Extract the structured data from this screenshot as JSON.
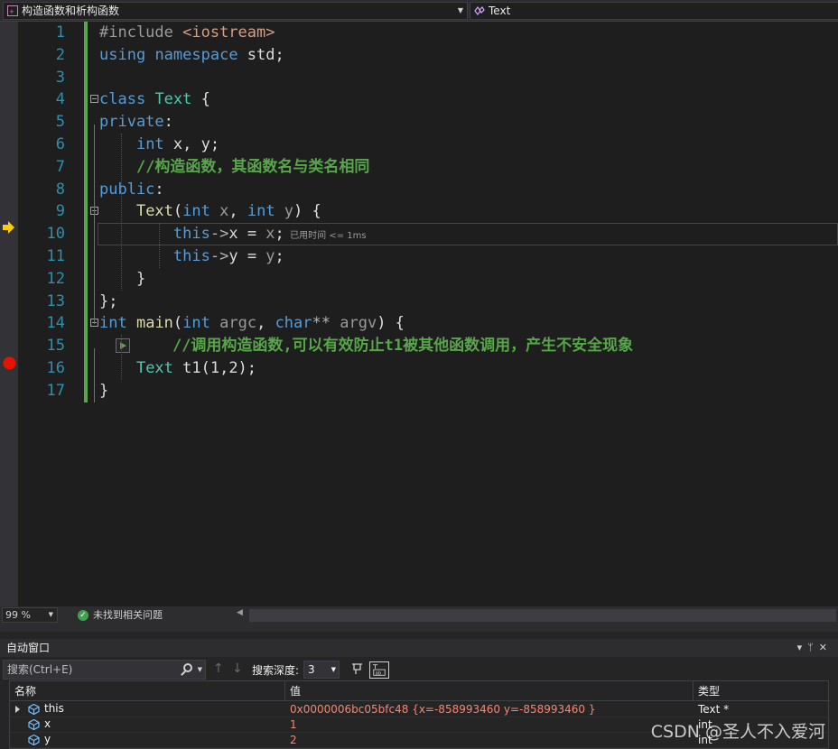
{
  "navbar": {
    "scope_label": "构造函数和析构函数",
    "member_label": "Text",
    "scope_icon": "cpp-file-icon",
    "member_icon": "class-icon"
  },
  "editor": {
    "lines": [
      {
        "n": "1",
        "tokens": [
          {
            "t": "#include ",
            "c": "pp"
          },
          {
            "t": "<iostream>",
            "c": "inc"
          }
        ]
      },
      {
        "n": "2",
        "tokens": [
          {
            "t": "using",
            "c": "kw"
          },
          {
            "t": " "
          },
          {
            "t": "namespace",
            "c": "kw"
          },
          {
            "t": " std;"
          }
        ]
      },
      {
        "n": "3",
        "tokens": []
      },
      {
        "n": "4",
        "tokens": [
          {
            "t": "class",
            "c": "kw"
          },
          {
            "t": " "
          },
          {
            "t": "Text",
            "c": "ty"
          },
          {
            "t": " {"
          }
        ]
      },
      {
        "n": "5",
        "tokens": [
          {
            "t": "private",
            "c": "kw"
          },
          {
            "t": ":"
          }
        ]
      },
      {
        "n": "6",
        "tokens": [
          {
            "t": "    "
          },
          {
            "t": "int",
            "c": "kw"
          },
          {
            "t": " x, y;"
          }
        ]
      },
      {
        "n": "7",
        "tokens": [
          {
            "t": "    "
          },
          {
            "t": "//构造函数，其函数名与类名相同",
            "c": "cm"
          }
        ]
      },
      {
        "n": "8",
        "tokens": [
          {
            "t": "public",
            "c": "kw"
          },
          {
            "t": ":"
          }
        ]
      },
      {
        "n": "9",
        "tokens": [
          {
            "t": "    "
          },
          {
            "t": "Text",
            "c": "fn"
          },
          {
            "t": "("
          },
          {
            "t": "int",
            "c": "kw"
          },
          {
            "t": " x",
            "c": "pm"
          },
          {
            "t": ", "
          },
          {
            "t": "int",
            "c": "kw"
          },
          {
            "t": " y",
            "c": "pm"
          },
          {
            "t": ") {"
          }
        ]
      },
      {
        "n": "10",
        "tokens": [
          {
            "t": "        "
          },
          {
            "t": "this",
            "c": "kw"
          },
          {
            "t": "->",
            "c": "op"
          },
          {
            "t": "x",
            "c": "mem"
          },
          {
            "t": " = "
          },
          {
            "t": "x",
            "c": "pm"
          },
          {
            "t": ";"
          }
        ]
      },
      {
        "n": "11",
        "tokens": [
          {
            "t": "        "
          },
          {
            "t": "this",
            "c": "kw"
          },
          {
            "t": "->",
            "c": "op"
          },
          {
            "t": "y",
            "c": "mem"
          },
          {
            "t": " = "
          },
          {
            "t": "y",
            "c": "pm"
          },
          {
            "t": ";"
          }
        ]
      },
      {
        "n": "12",
        "tokens": [
          {
            "t": "    }"
          }
        ]
      },
      {
        "n": "13",
        "tokens": [
          {
            "t": "};"
          }
        ]
      },
      {
        "n": "14",
        "tokens": [
          {
            "t": "int",
            "c": "kw"
          },
          {
            "t": " "
          },
          {
            "t": "main",
            "c": "fn"
          },
          {
            "t": "("
          },
          {
            "t": "int",
            "c": "kw"
          },
          {
            "t": " argc",
            "c": "pm"
          },
          {
            "t": ", "
          },
          {
            "t": "char",
            "c": "kw"
          },
          {
            "t": "**",
            "c": "op"
          },
          {
            "t": " argv",
            "c": "pm"
          },
          {
            "t": ") {"
          }
        ]
      },
      {
        "n": "15",
        "tokens": [
          {
            "t": "    "
          },
          {
            "t": "//调用构造函数,可以有效防止t1被其他函数调用，产生不安全现象",
            "c": "cm"
          }
        ]
      },
      {
        "n": "16",
        "tokens": [
          {
            "t": "    "
          },
          {
            "t": "Text",
            "c": "ty"
          },
          {
            "t": " t1(1,2);"
          }
        ]
      },
      {
        "n": "17",
        "tokens": [
          {
            "t": "}"
          }
        ]
      }
    ],
    "perf_tip": "已用时间 <= 1ms",
    "current_line": "10",
    "breakpoint_line": "16",
    "colors": {
      "keyword": "#569cd6",
      "type": "#4ec9b0",
      "function": "#dcdcaa",
      "comment": "#57a64a",
      "line_number": "#2b91af",
      "breakpoint": "#e51400",
      "instruction_pointer": "#ffcc00"
    }
  },
  "status": {
    "zoom": "99 %",
    "issues": "未找到相关问题"
  },
  "autos": {
    "title": "自动窗口",
    "search_placeholder": "搜索(Ctrl+E)",
    "depth_label": "搜索深度:",
    "depth_value": "3",
    "columns": [
      "名称",
      "值",
      "类型"
    ],
    "rows": [
      {
        "name": "this",
        "value": "0x0000006bc05bfc48 {x=-858993460 y=-858993460 }",
        "type": "Text *",
        "expandable": true
      },
      {
        "name": "x",
        "value": "1",
        "type": "int",
        "expandable": false
      },
      {
        "name": "y",
        "value": "2",
        "type": "int",
        "expandable": false
      }
    ]
  },
  "watermark": "CSDN @圣人不入爱河"
}
